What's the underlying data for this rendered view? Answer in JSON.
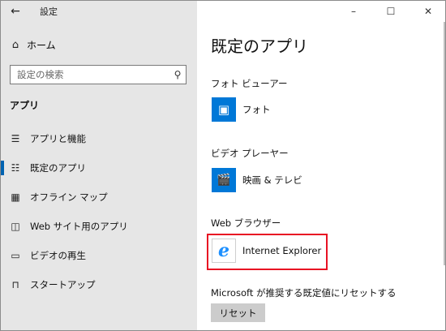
{
  "window": {
    "title": "設定",
    "back_icon": "←",
    "controls": {
      "minimize": "–",
      "maximize": "☐",
      "close": "✕"
    }
  },
  "sidebar": {
    "home": {
      "icon": "⌂",
      "label": "ホーム"
    },
    "search": {
      "placeholder": "設定の検索",
      "icon": "⚲"
    },
    "section_label": "アプリ",
    "items": [
      {
        "icon": "☰",
        "label": "アプリと機能",
        "active": false
      },
      {
        "icon": "☷",
        "label": "既定のアプリ",
        "active": true
      },
      {
        "icon": "▦",
        "label": "オフライン マップ",
        "active": false
      },
      {
        "icon": "◫",
        "label": "Web サイト用のアプリ",
        "active": false
      },
      {
        "icon": "▭",
        "label": "ビデオの再生",
        "active": false
      },
      {
        "icon": "⊓",
        "label": "スタートアップ",
        "active": false
      }
    ]
  },
  "main": {
    "title": "既定のアプリ",
    "groups": [
      {
        "label": "フォト ビューアー",
        "app": {
          "icon": "▣",
          "name": "フォト"
        }
      },
      {
        "label": "ビデオ プレーヤー",
        "app": {
          "icon": "🎬",
          "name": "映画 & テレビ"
        }
      },
      {
        "label": "Web ブラウザー",
        "app": {
          "icon": "e",
          "name": "Internet Explorer"
        }
      }
    ],
    "reset": {
      "text": "Microsoft が推奨する既定値にリセットする",
      "button": "リセット"
    }
  },
  "colors": {
    "accent": "#0078d7",
    "active_indicator": "#0063b1",
    "highlight": "#e81123",
    "sidebar_bg": "#e6e6e6"
  }
}
